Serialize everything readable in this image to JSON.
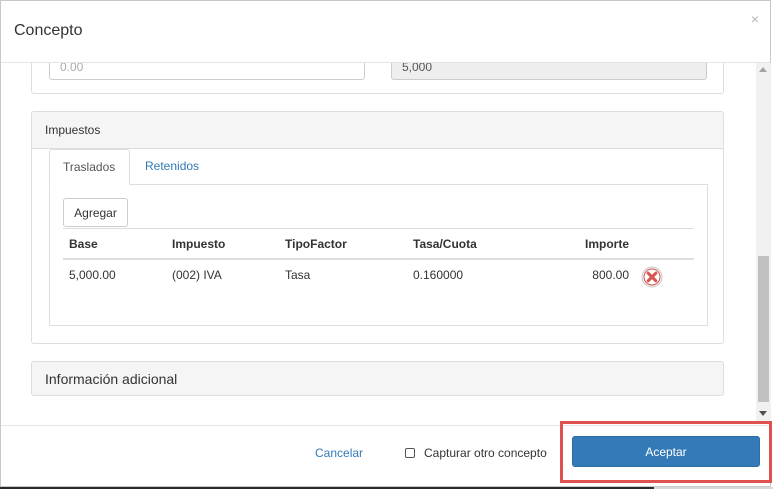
{
  "modal": {
    "title": "Concepto",
    "close_glyph": "×"
  },
  "top_fields": {
    "left_placeholder": "0.00",
    "right_value": "5,000"
  },
  "impuestos": {
    "title": "Impuestos",
    "tabs": [
      {
        "label": "Traslados",
        "active": true
      },
      {
        "label": "Retenidos",
        "active": false
      }
    ],
    "add_button": "Agregar",
    "columns": [
      "Base",
      "Impuesto",
      "TipoFactor",
      "Tasa/Cuota",
      "Importe"
    ],
    "rows": [
      {
        "base": "5,000.00",
        "impuesto": "(002) IVA",
        "tipo_factor": "Tasa",
        "tasa_cuota": "0.160000",
        "importe": "800.00"
      }
    ]
  },
  "info_adicional": {
    "title": "Información adicional"
  },
  "footer": {
    "cancel_label": "Cancelar",
    "checkbox_label": "Capturar otro concepto",
    "checkbox_checked": false,
    "accept_label": "Aceptar"
  },
  "colors": {
    "accent": "#337ab7",
    "highlight": "#e05252",
    "delete_icon": "#d9534f"
  },
  "icons": {
    "delete": "delete-x-circle-icon",
    "close": "close-icon"
  }
}
